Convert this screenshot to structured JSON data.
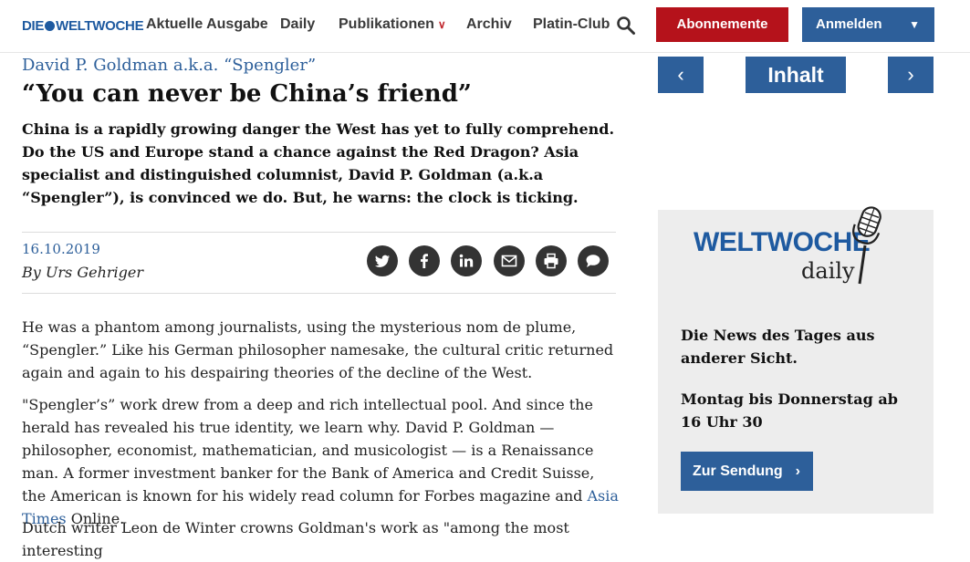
{
  "header": {
    "logo": {
      "left": "DIE",
      "right": "WELTWOCHE"
    },
    "nav": [
      "Aktuelle Ausgabe",
      "Daily",
      "Publikationen",
      "Archiv",
      "Platin-Club"
    ],
    "subscribe_label": "Abonnemente",
    "login_label": "Anmelden"
  },
  "article": {
    "kicker": "David P. Goldman a.k.a. “Spengler”",
    "title": "“You can never be China’s friend”",
    "lead": "China is a rapidly growing danger the West has yet to fully comprehend. Do the US and Europe stand a chance against the Red Dragon? Asia specialist and distinguished columnist, David P. Goldman (a.k.a “Spengler”), is convinced we do. But, he warns: the clock is ticking.",
    "date": "16.10.2019",
    "author": "By Urs Gehriger",
    "paragraph1": "He was a phantom among journalists, using the mysterious nom de plume, “Spengler.” Like his German philosopher namesake, the cultural critic returned again and again to his despairing theories of the decline of the West.",
    "paragraph2_before": "\"Spengler’s” work drew from a deep and rich intellectual pool. And since the herald has revealed his true identity, we learn why. David P. Goldman — philosopher, economist, mathematician, and musicologist — is a Renaissance man. A former investment banker for the Bank of America and Credit Suisse, the American is known for his widely read column for Forbes magazine and ",
    "paragraph2_link": "Asia Times",
    "paragraph2_after": " Online.",
    "paragraph3": "Dutch writer Leon de Winter crowns Goldman's work as \"among the most interesting"
  },
  "share_icons": [
    "twitter-icon",
    "facebook-icon",
    "linkedin-icon",
    "mail-icon",
    "print-icon",
    "comment-icon"
  ],
  "sidebar": {
    "prev": "‹",
    "inhalt": "Inhalt",
    "next": "›",
    "daily_logo": "WELTWOCHE",
    "daily_sub": "daily",
    "text1": "Die News des Tages aus anderer Sicht.",
    "text2": "Montag bis Donnerstag ab 16 Uhr 30",
    "button": "Zur Sendung"
  },
  "colors": {
    "brand_blue": "#2d5f9a",
    "brand_red": "#b5121b"
  }
}
